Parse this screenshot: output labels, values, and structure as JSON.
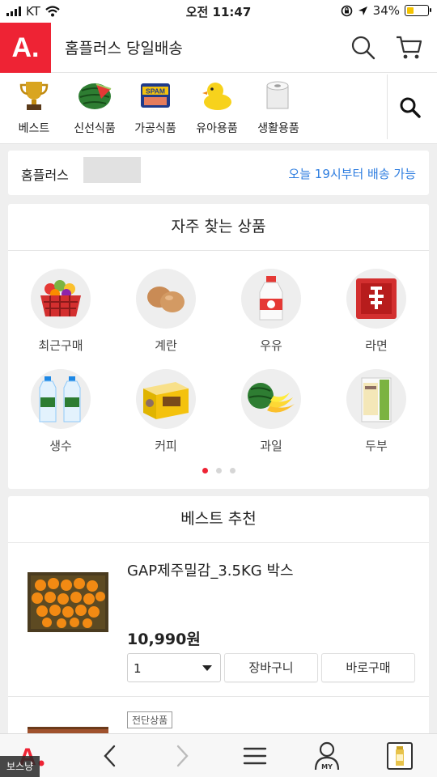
{
  "status_bar": {
    "carrier": "KT",
    "time": "오전 11:47",
    "battery": "34%",
    "battery_level": 0.34
  },
  "header": {
    "logo": "A.",
    "title": "홈플러스 당일배송"
  },
  "categories": [
    {
      "label": "베스트",
      "icon": "trophy-icon"
    },
    {
      "label": "신선식품",
      "icon": "watermelon-icon"
    },
    {
      "label": "가공식품",
      "icon": "spam-can-icon"
    },
    {
      "label": "유아용품",
      "icon": "rubber-duck-icon"
    },
    {
      "label": "생활용품",
      "icon": "toilet-paper-icon"
    }
  ],
  "info": {
    "store": "홈플러스",
    "delivery": "오늘 19시부터 배송 가능"
  },
  "frequent": {
    "title": "자주 찾는 상품",
    "items": [
      {
        "label": "최근구매",
        "icon": "grocery-basket-icon"
      },
      {
        "label": "계란",
        "icon": "eggs-icon"
      },
      {
        "label": "우유",
        "icon": "milk-icon"
      },
      {
        "label": "라면",
        "icon": "ramen-icon"
      },
      {
        "label": "생수",
        "icon": "water-bottle-icon"
      },
      {
        "label": "커피",
        "icon": "coffee-box-icon"
      },
      {
        "label": "과일",
        "icon": "fruit-icon"
      },
      {
        "label": "두부",
        "icon": "tofu-icon"
      }
    ],
    "page_count": 3,
    "active_page": 1
  },
  "best": {
    "title": "베스트 추천",
    "products": [
      {
        "name": "GAP제주밀감_3.5KG 박스",
        "price": "10,990원",
        "quantity": "1",
        "cart_label": "장바구니",
        "buy_label": "바로구매"
      }
    ],
    "next_badge": "전단상품"
  },
  "bottom_nav": {
    "logo": "A",
    "my_label": "MY"
  },
  "watermark": "보스냥",
  "colors": {
    "brand_red": "#ee2334",
    "link_blue": "#2f7ee0",
    "battery_yellow": "#f5c400"
  }
}
